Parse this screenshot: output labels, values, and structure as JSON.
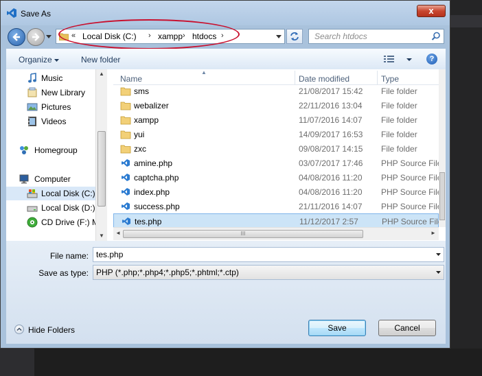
{
  "window": {
    "title": "Save As",
    "close_label": "x"
  },
  "address": {
    "overflow": "«",
    "separator": "›",
    "segments": [
      "Local Disk (C:)",
      "xampp",
      "htdocs"
    ]
  },
  "search": {
    "placeholder": "Search htdocs"
  },
  "toolbar": {
    "organize": "Organize",
    "new_folder": "New folder",
    "help": "?"
  },
  "sidebar": {
    "items": [
      {
        "label": "Music",
        "icon": "music-icon"
      },
      {
        "label": "New Library",
        "icon": "library-icon"
      },
      {
        "label": "Pictures",
        "icon": "pictures-icon"
      },
      {
        "label": "Videos",
        "icon": "videos-icon"
      },
      {
        "label": "Homegroup",
        "icon": "homegroup-icon"
      },
      {
        "label": "Computer",
        "icon": "computer-icon"
      },
      {
        "label": "Local Disk (C:)",
        "icon": "drive-icon"
      },
      {
        "label": "Local Disk (D:)",
        "icon": "drive-icon"
      },
      {
        "label": "CD Drive (F:) M",
        "icon": "cd-drive-icon"
      }
    ]
  },
  "columns": {
    "name": "Name",
    "date": "Date modified",
    "type": "Type"
  },
  "files": [
    {
      "name": "sms",
      "date": "21/08/2017 15:42",
      "type": "File folder",
      "kind": "folder"
    },
    {
      "name": "webalizer",
      "date": "22/11/2016 13:04",
      "type": "File folder",
      "kind": "folder"
    },
    {
      "name": "xampp",
      "date": "11/07/2016 14:07",
      "type": "File folder",
      "kind": "folder"
    },
    {
      "name": "yui",
      "date": "14/09/2017 16:53",
      "type": "File folder",
      "kind": "folder"
    },
    {
      "name": "zxc",
      "date": "09/08/2017 14:15",
      "type": "File folder",
      "kind": "folder"
    },
    {
      "name": "amine.php",
      "date": "03/07/2017 17:46",
      "type": "PHP Source File",
      "kind": "php"
    },
    {
      "name": "captcha.php",
      "date": "04/08/2016 11:20",
      "type": "PHP Source File",
      "kind": "php"
    },
    {
      "name": "index.php",
      "date": "04/08/2016 11:20",
      "type": "PHP Source File",
      "kind": "php"
    },
    {
      "name": "success.php",
      "date": "21/11/2016 14:07",
      "type": "PHP Source File",
      "kind": "php"
    },
    {
      "name": "tes.php",
      "date": "11/12/2017 2:57",
      "type": "PHP Source File",
      "kind": "php"
    }
  ],
  "scroll_grip": "III",
  "form": {
    "file_name_label": "File name:",
    "file_name_value": "tes.php",
    "save_type_label": "Save as type:",
    "save_type_value": "PHP (*.php;*.php4;*.php5;*.phtml;*.ctp)"
  },
  "footer": {
    "hide_folders": "Hide Folders",
    "save": "Save",
    "cancel": "Cancel"
  },
  "colors": {
    "accent": "#3c7fb1",
    "annotation": "#c8102e",
    "selection": "#cce4f7"
  }
}
